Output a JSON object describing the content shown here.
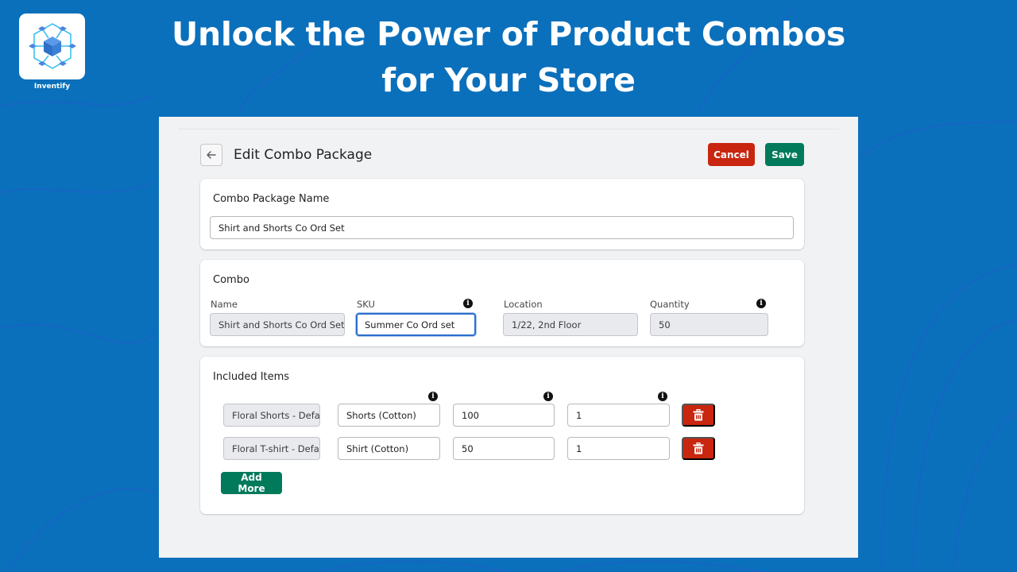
{
  "brand": {
    "name": "Inventify",
    "logo_icon": "cube-network-icon"
  },
  "hero": {
    "line1": "Unlock the Power of Product Combos",
    "line2": "for Your Store"
  },
  "colors": {
    "background": "#0b70bb",
    "panel": "#f1f2f4",
    "cancel": "#c8260f",
    "save": "#007a5b",
    "delete": "#c8260f",
    "focus": "#2c6ecb"
  },
  "header": {
    "back_icon": "arrow-left-icon",
    "title": "Edit Combo Package",
    "cancel_label": "Cancel",
    "save_label": "Save"
  },
  "package_card": {
    "title": "Combo Package Name",
    "name_value": "Shirt and Shorts Co Ord Set"
  },
  "combo_card": {
    "title": "Combo",
    "fields": {
      "name": {
        "label": "Name",
        "value": "Shirt and Shorts Co Ord Set - Default",
        "disabled": true
      },
      "sku": {
        "label": "SKU",
        "value": "Summer Co Ord set",
        "focused": true,
        "info_icon": "info-icon"
      },
      "location": {
        "label": "Location",
        "value": "1/22, 2nd Floor",
        "disabled": true
      },
      "quantity": {
        "label": "Quantity",
        "value": "50",
        "disabled": true,
        "info_icon": "info-icon"
      }
    }
  },
  "items_card": {
    "title": "Included Items",
    "rows": [
      {
        "product": "Floral Shorts - Default",
        "description": "Shorts (Cotton)",
        "stock": "100",
        "qty": "1",
        "delete_icon": "trash-icon"
      },
      {
        "product": "Floral T-shirt - Default",
        "description": "Shirt (Cotton)",
        "stock": "50",
        "qty": "1",
        "delete_icon": "trash-icon"
      }
    ],
    "add_more_label": "Add More"
  }
}
